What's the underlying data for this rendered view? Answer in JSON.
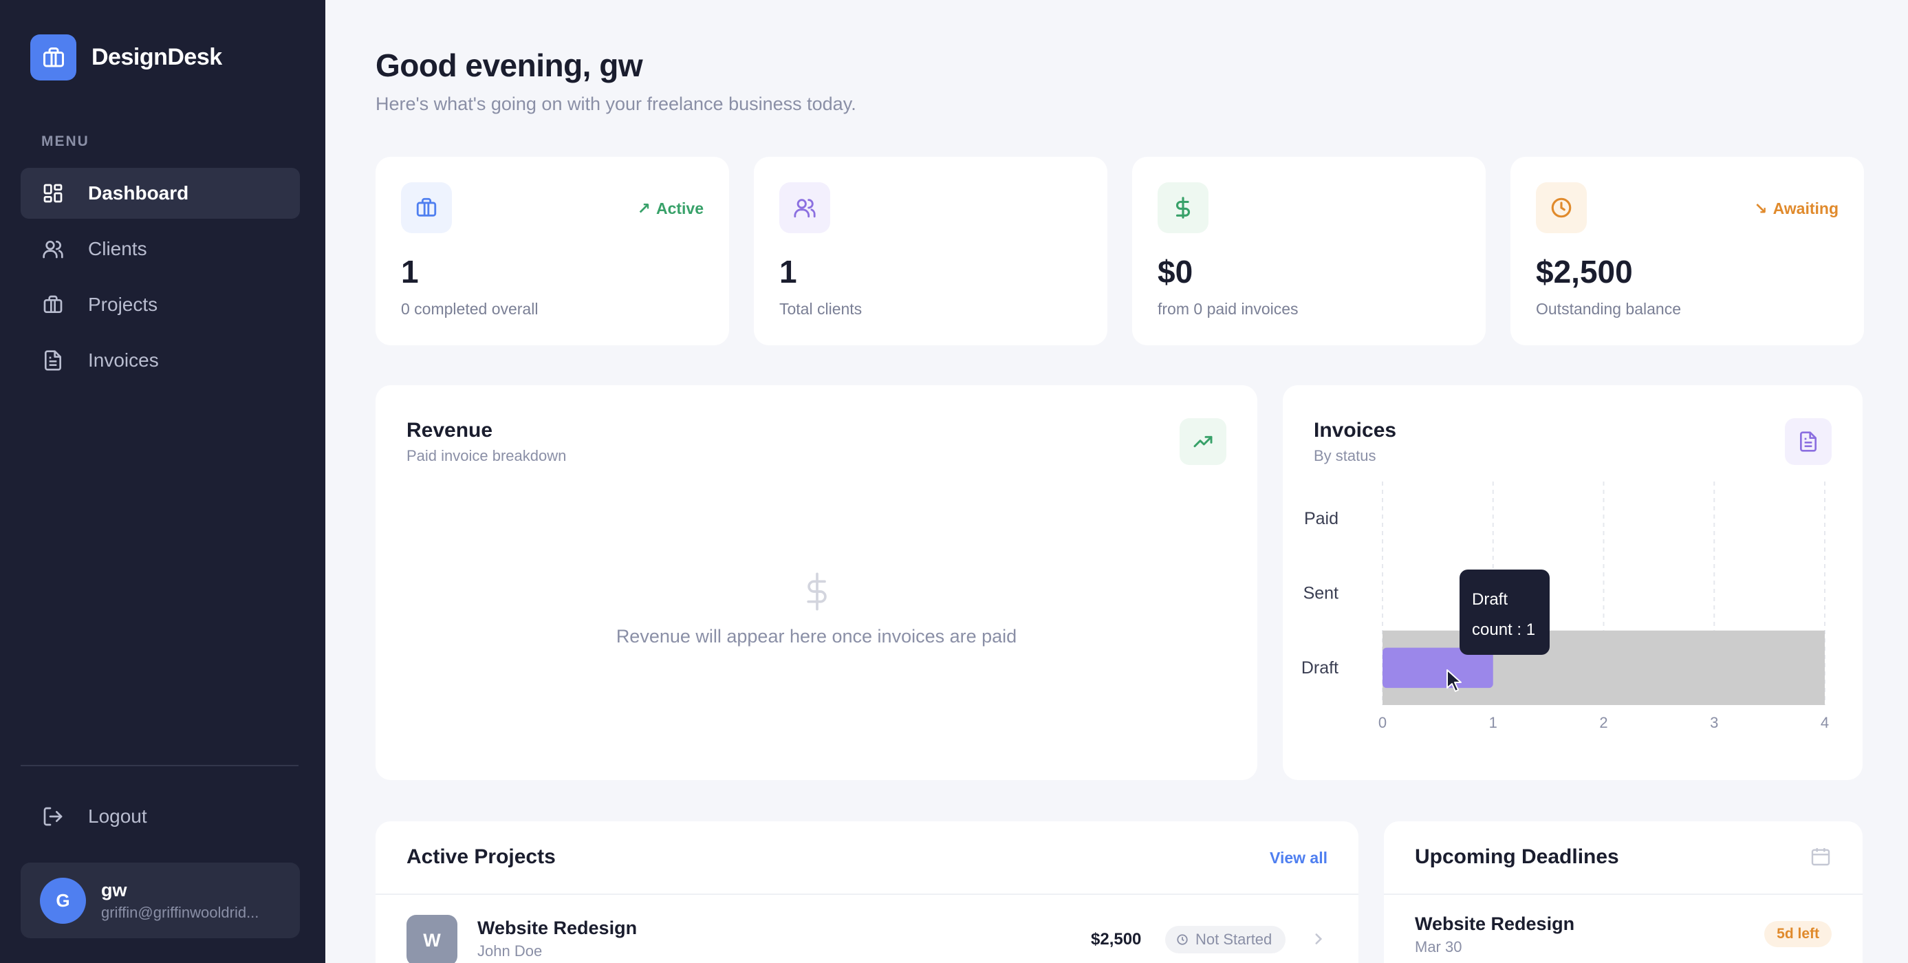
{
  "app": {
    "name": "DesignDesk"
  },
  "sidebar": {
    "menu_label": "MENU",
    "items": [
      {
        "label": "Dashboard",
        "icon": "dashboard-icon",
        "active": true
      },
      {
        "label": "Clients",
        "icon": "users-icon",
        "active": false
      },
      {
        "label": "Projects",
        "icon": "briefcase-icon",
        "active": false
      },
      {
        "label": "Invoices",
        "icon": "file-text-icon",
        "active": false
      }
    ],
    "logout_label": "Logout",
    "user": {
      "initial": "G",
      "name": "gw",
      "email": "griffin@griffinwooldrid..."
    }
  },
  "header": {
    "greeting": "Good evening, gw",
    "subtitle": "Here's what's going on with your freelance business today."
  },
  "stats": [
    {
      "value": "1",
      "label": "0 completed overall",
      "badge": "Active",
      "badge_arrow": "↗",
      "icon": "briefcase-icon",
      "accent": "#4f7ff0",
      "accent_bg": "#eef3fe",
      "badge_color": "#38a169"
    },
    {
      "value": "1",
      "label": "Total clients",
      "badge": "",
      "icon": "users-icon",
      "accent": "#8b6fe0",
      "accent_bg": "#f3f0fd"
    },
    {
      "value": "$0",
      "label": "from 0 paid invoices",
      "badge": "",
      "icon": "dollar-icon",
      "accent": "#38a169",
      "accent_bg": "#eef8f1"
    },
    {
      "value": "$2,500",
      "label": "Outstanding balance",
      "badge": "Awaiting",
      "badge_arrow": "↘",
      "icon": "clock-icon",
      "accent": "#e08a2c",
      "accent_bg": "#fdf3e6",
      "badge_color": "#e08a2c"
    }
  ],
  "revenue": {
    "title": "Revenue",
    "subtitle": "Paid invoice breakdown",
    "empty_message": "Revenue will appear here once invoices are paid",
    "icon": "trending-up-icon"
  },
  "invoices_panel": {
    "title": "Invoices",
    "subtitle": "By status",
    "icon": "file-text-icon"
  },
  "chart_data": {
    "type": "bar",
    "orientation": "horizontal",
    "categories": [
      "Paid",
      "Sent",
      "Draft"
    ],
    "values": [
      0,
      0,
      1
    ],
    "xlim": [
      0,
      4
    ],
    "xticks": [
      "0",
      "1",
      "2",
      "3",
      "4"
    ],
    "grid": true,
    "bar_color": "#9b87ea",
    "hover_color": "#cccccc",
    "tooltip": {
      "label": "Draft",
      "text": "count : 1"
    }
  },
  "active_projects": {
    "title": "Active Projects",
    "view_all": "View all",
    "rows": [
      {
        "initial": "W",
        "name": "Website Redesign",
        "client": "John Doe",
        "amount": "$2,500",
        "status": "Not Started"
      }
    ]
  },
  "deadlines": {
    "title": "Upcoming Deadlines",
    "icon": "calendar-icon",
    "rows": [
      {
        "name": "Website Redesign",
        "date": "Mar 30",
        "left": "5d left"
      }
    ]
  }
}
